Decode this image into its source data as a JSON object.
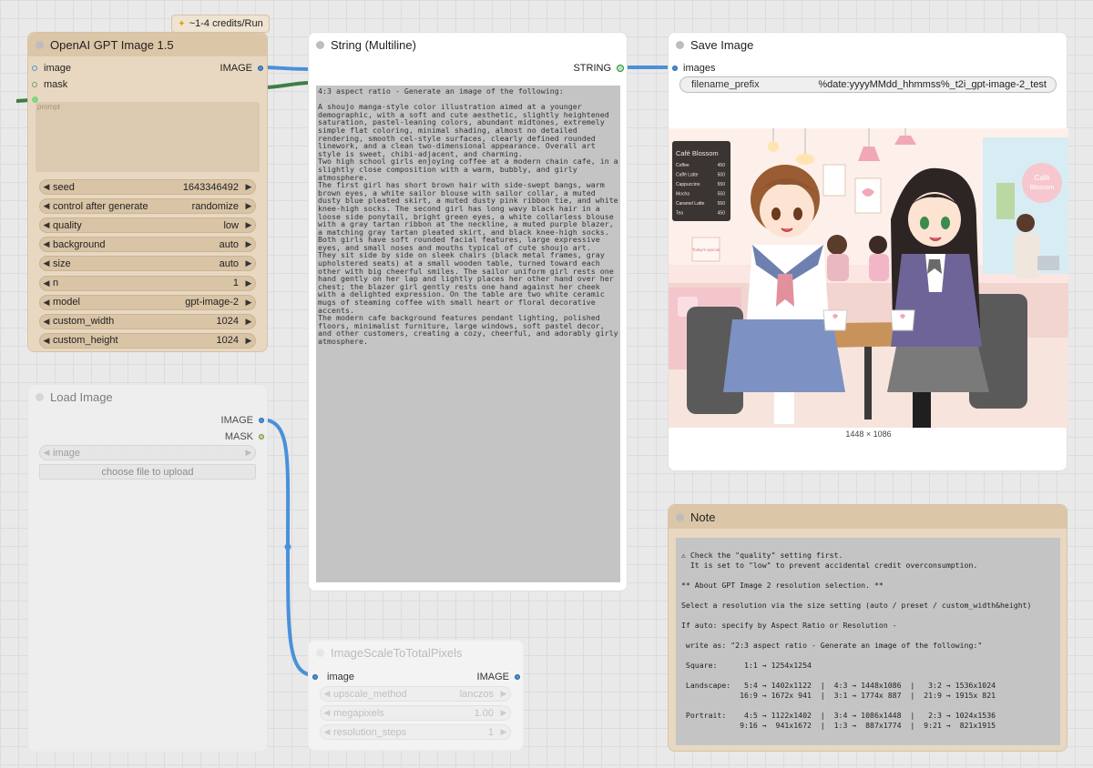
{
  "colors": {
    "image_wire": "#4a90d9",
    "mask_wire": "#3e7d46",
    "string_wire": "#4a90d9",
    "node_tan": "#e9d8c1"
  },
  "openai": {
    "badge": "~1-4 credits/Run",
    "title": "OpenAI GPT Image 1.5",
    "inputs": {
      "image": "image",
      "mask": "mask",
      "prompt_placeholder": "prompt"
    },
    "output": "IMAGE",
    "widgets": [
      {
        "label": "seed",
        "value": "1643346492"
      },
      {
        "label": "control after generate",
        "value": "randomize"
      },
      {
        "label": "quality",
        "value": "low"
      },
      {
        "label": "background",
        "value": "auto"
      },
      {
        "label": "size",
        "value": "auto"
      },
      {
        "label": "n",
        "value": "1"
      },
      {
        "label": "model",
        "value": "gpt-image-2"
      },
      {
        "label": "custom_width",
        "value": "1024"
      },
      {
        "label": "custom_height",
        "value": "1024"
      }
    ]
  },
  "string": {
    "title": "String (Multiline)",
    "output": "STRING",
    "text": "4:3 aspect ratio - Generate an image of the following:\n\nA shoujo manga-style color illustration aimed at a younger demographic, with a soft and cute aesthetic, slightly heightened saturation, pastel-leaning colors, abundant midtones, extremely simple flat coloring, minimal shading, almost no detailed rendering, smooth cel-style surfaces, clearly defined rounded linework, and a clean two-dimensional appearance. Overall art style is sweet, chibi-adjacent, and charming.\nTwo high school girls enjoying coffee at a modern chain cafe, in a slightly close composition with a warm, bubbly, and girly atmosphere.\nThe first girl has short brown hair with side-swept bangs, warm brown eyes, a white sailor blouse with sailor collar, a muted dusty blue pleated skirt, a muted dusty pink ribbon tie, and white knee-high socks. The second girl has long wavy black hair in a loose side ponytail, bright green eyes, a white collarless blouse with a gray tartan ribbon at the neckline, a muted purple blazer, a matching gray tartan pleated skirt, and black knee-high socks. Both girls have soft rounded facial features, large expressive eyes, and small noses and mouths typical of cute shoujo art.\nThey sit side by side on sleek chairs (black metal frames, gray upholstered seats) at a small wooden table, turned toward each other with big cheerful smiles. The sailor uniform girl rests one hand gently on her lap and lightly places her other hand over her chest; the blazer girl gently rests one hand against her cheek with a delighted expression. On the table are two white ceramic mugs of steaming coffee with small heart or floral decorative accents.\nThe modern cafe background features pendant lighting, polished floors, minimalist furniture, large windows, soft pastel decor, and other customers, creating a cozy, cheerful, and adorably girly atmosphere."
  },
  "save": {
    "title": "Save Image",
    "input": "images",
    "prefix_label": "filename_prefix",
    "prefix_value": "%date:yyyyMMdd_hhmmss%_t2i_gpt-image-2_test",
    "image_size": "1448 × 1086",
    "illustration": {
      "sign_title": "Café Blossom",
      "menu": [
        [
          "Coffee",
          "450"
        ],
        [
          "Caffè Latte",
          "500"
        ],
        [
          "Cappuccino",
          "550"
        ],
        [
          "Mocha",
          "550"
        ],
        [
          "Caramel Latte",
          "550"
        ],
        [
          "Tea",
          "450"
        ]
      ],
      "window_sign_1": "Café",
      "window_sign_2": "Blossom",
      "small_sign": "Today's special"
    }
  },
  "load": {
    "title": "Load Image",
    "outputs": [
      "IMAGE",
      "MASK"
    ],
    "image_widget": "image",
    "upload_button": "choose file to upload"
  },
  "scale": {
    "title": "ImageScaleToTotalPixels",
    "input": "image",
    "output": "IMAGE",
    "widgets": [
      {
        "label": "upscale_method",
        "value": "lanczos"
      },
      {
        "label": "megapixels",
        "value": "1.00"
      },
      {
        "label": "resolution_steps",
        "value": "1"
      }
    ]
  },
  "note": {
    "title": "Note",
    "text": "⚠ Check the \"quality\" setting first.\n  It is set to \"low\" to prevent accidental credit overconsumption.\n\n** About GPT Image 2 resolution selection. **\n\nSelect a resolution via the size setting (auto / preset / custom_width&height)\n\nIf auto: specify by Aspect Ratio or Resolution -\n\n write as: \"2:3 aspect ratio - Generate an image of the following:\"\n\n Square:      1:1 → 1254x1254\n\n Landscape:   5:4 → 1402x1122  |  4:3 → 1448x1086  |   3:2 → 1536x1024\n             16:9 → 1672x 941  |  3:1 → 1774x 887  |  21:9 → 1915x 821\n\n Portrait:    4:5 → 1122x1402  |  3:4 → 1086x1448  |   2:3 → 1024x1536\n             9:16 →  941x1672  |  1:3 →  887x1774  |  9:21 →  821x1915"
  }
}
